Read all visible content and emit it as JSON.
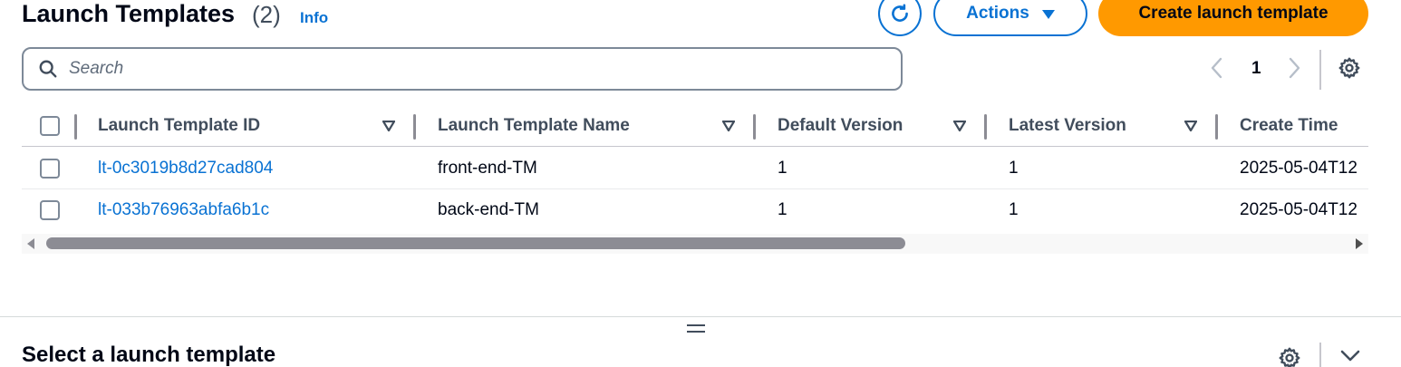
{
  "header": {
    "title": "Launch Templates",
    "count": "(2)",
    "info_label": "Info",
    "actions_label": "Actions",
    "create_label": "Create launch template"
  },
  "search": {
    "placeholder": "Search"
  },
  "pagination": {
    "current_page": "1"
  },
  "table": {
    "columns": [
      "Launch Template ID",
      "Launch Template Name",
      "Default Version",
      "Latest Version",
      "Create Time"
    ],
    "rows": [
      {
        "id": "lt-0c3019b8d27cad804",
        "name": "front-end-TM",
        "default_version": "1",
        "latest_version": "1",
        "create_time": "2025-05-04T12"
      },
      {
        "id": "lt-033b76963abfa6b1c",
        "name": "back-end-TM",
        "default_version": "1",
        "latest_version": "1",
        "create_time": "2025-05-04T12"
      }
    ]
  },
  "bottom_panel": {
    "title": "Select a launch template"
  },
  "colors": {
    "link": "#0972d3",
    "primary_button": "#ff9900",
    "text": "#000716"
  },
  "icons": [
    "search-icon",
    "refresh-icon",
    "caret-down-icon",
    "chevron-left-icon",
    "chevron-right-icon",
    "gear-icon",
    "sort-icon",
    "chevron-down-icon"
  ]
}
